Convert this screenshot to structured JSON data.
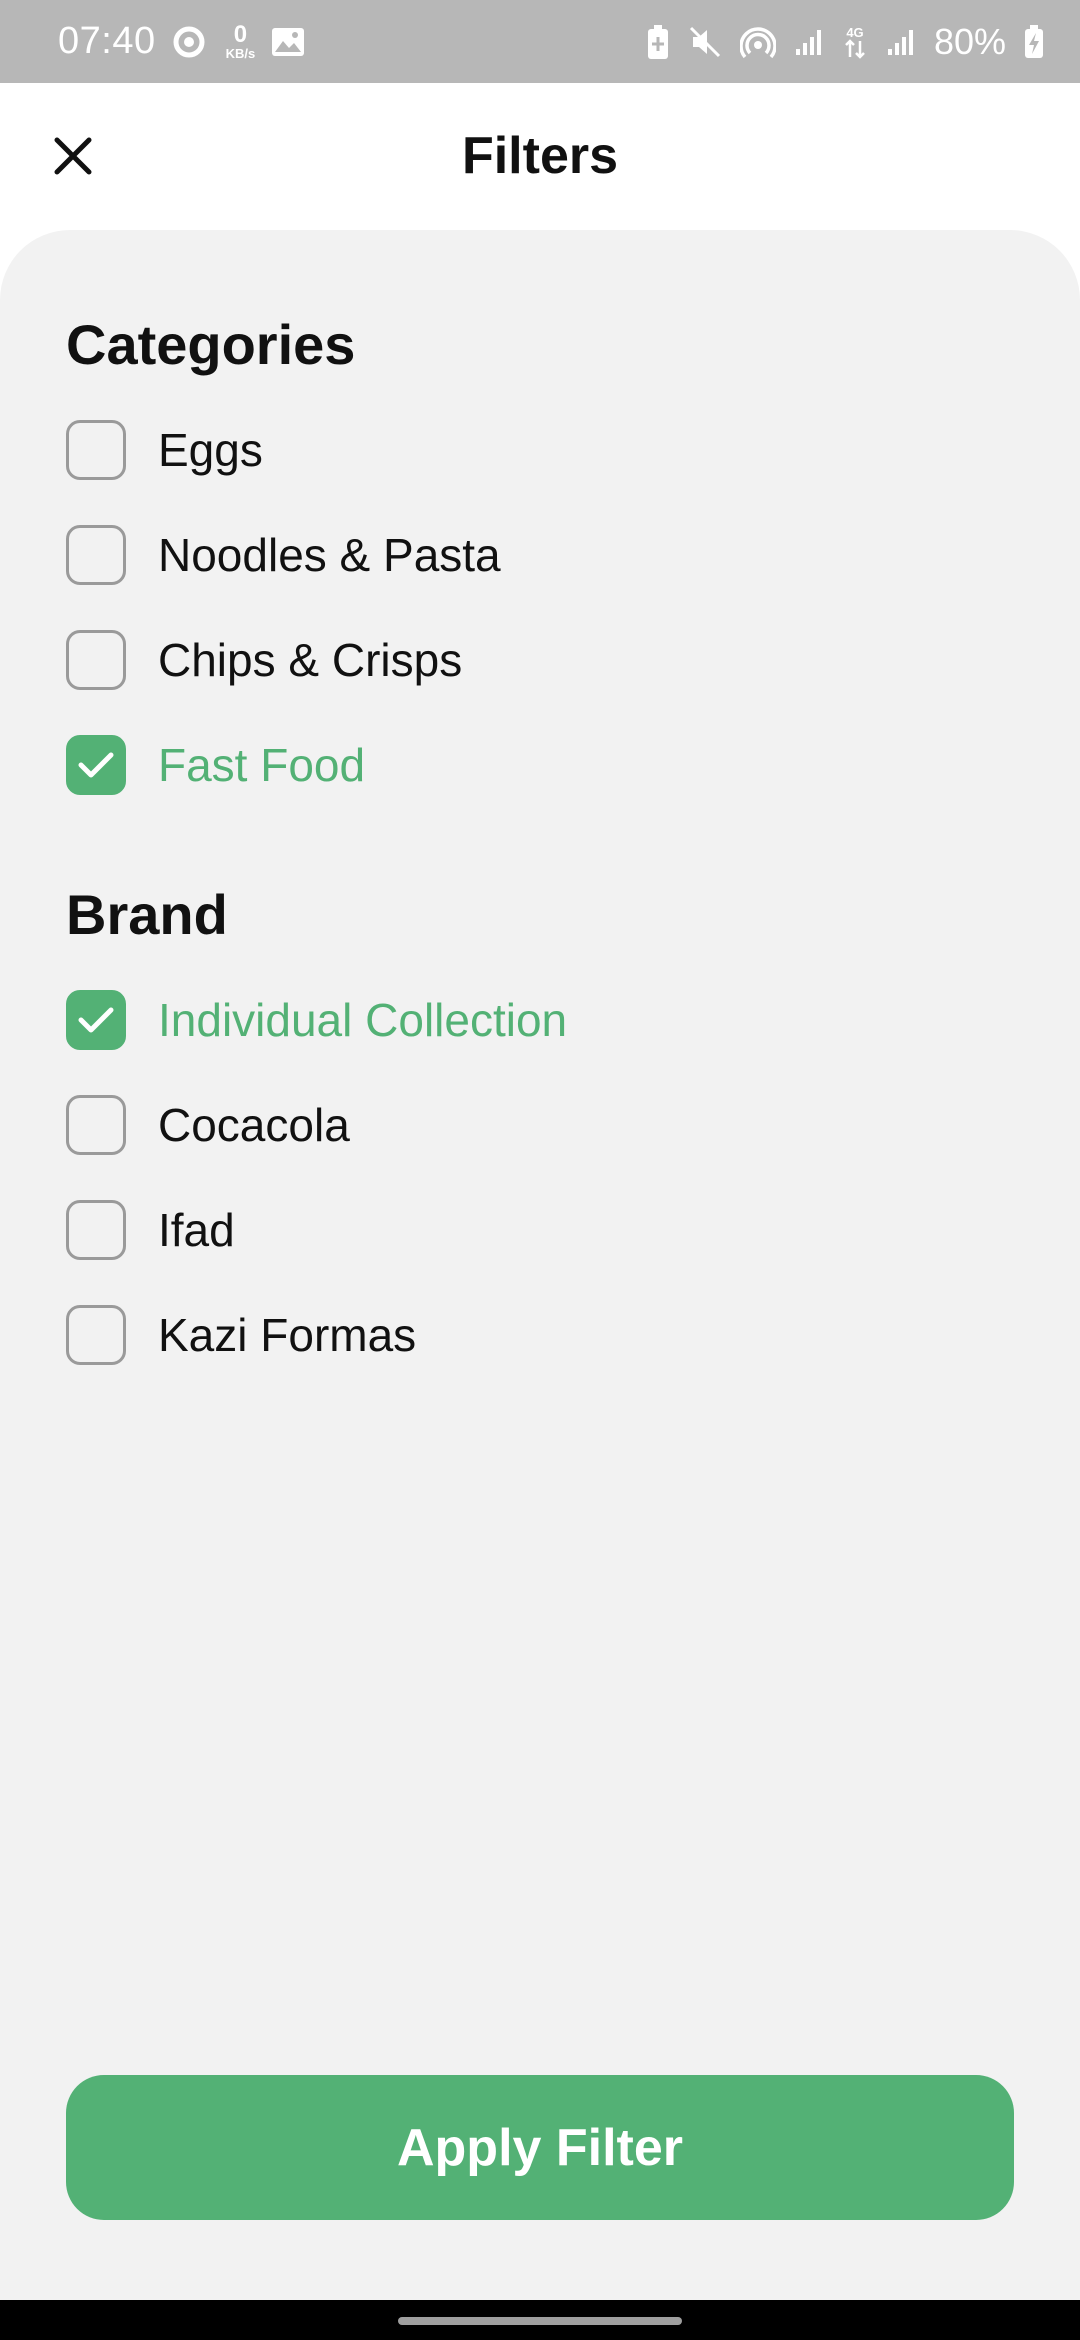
{
  "status_bar": {
    "time": "07:40",
    "net_speed_value": "0",
    "net_speed_unit": "KB/s",
    "battery": "80%",
    "icons": [
      "sync-icon",
      "image-icon",
      "battery-saver-icon",
      "mute-icon",
      "hotspot-icon",
      "signal-icon",
      "4g-data-icon",
      "signal-icon",
      "battery-charging-icon"
    ]
  },
  "header": {
    "title": "Filters",
    "close_icon": "close-icon"
  },
  "categories": {
    "title": "Categories",
    "items": [
      {
        "label": "Eggs",
        "checked": false
      },
      {
        "label": "Noodles & Pasta",
        "checked": false
      },
      {
        "label": "Chips & Crisps",
        "checked": false
      },
      {
        "label": "Fast Food",
        "checked": true
      }
    ]
  },
  "brand": {
    "title": "Brand",
    "items": [
      {
        "label": "Individual Collection",
        "checked": true
      },
      {
        "label": "Cocacola",
        "checked": false
      },
      {
        "label": "Ifad",
        "checked": false
      },
      {
        "label": "Kazi Formas",
        "checked": false
      }
    ]
  },
  "apply_button": {
    "label": "Apply Filter"
  },
  "colors": {
    "accent": "#53B175",
    "panel_background": "#F2F2F2",
    "status_bar": "#B7B7B7",
    "text": "#111111",
    "checkbox_border": "#9A9A9A"
  }
}
